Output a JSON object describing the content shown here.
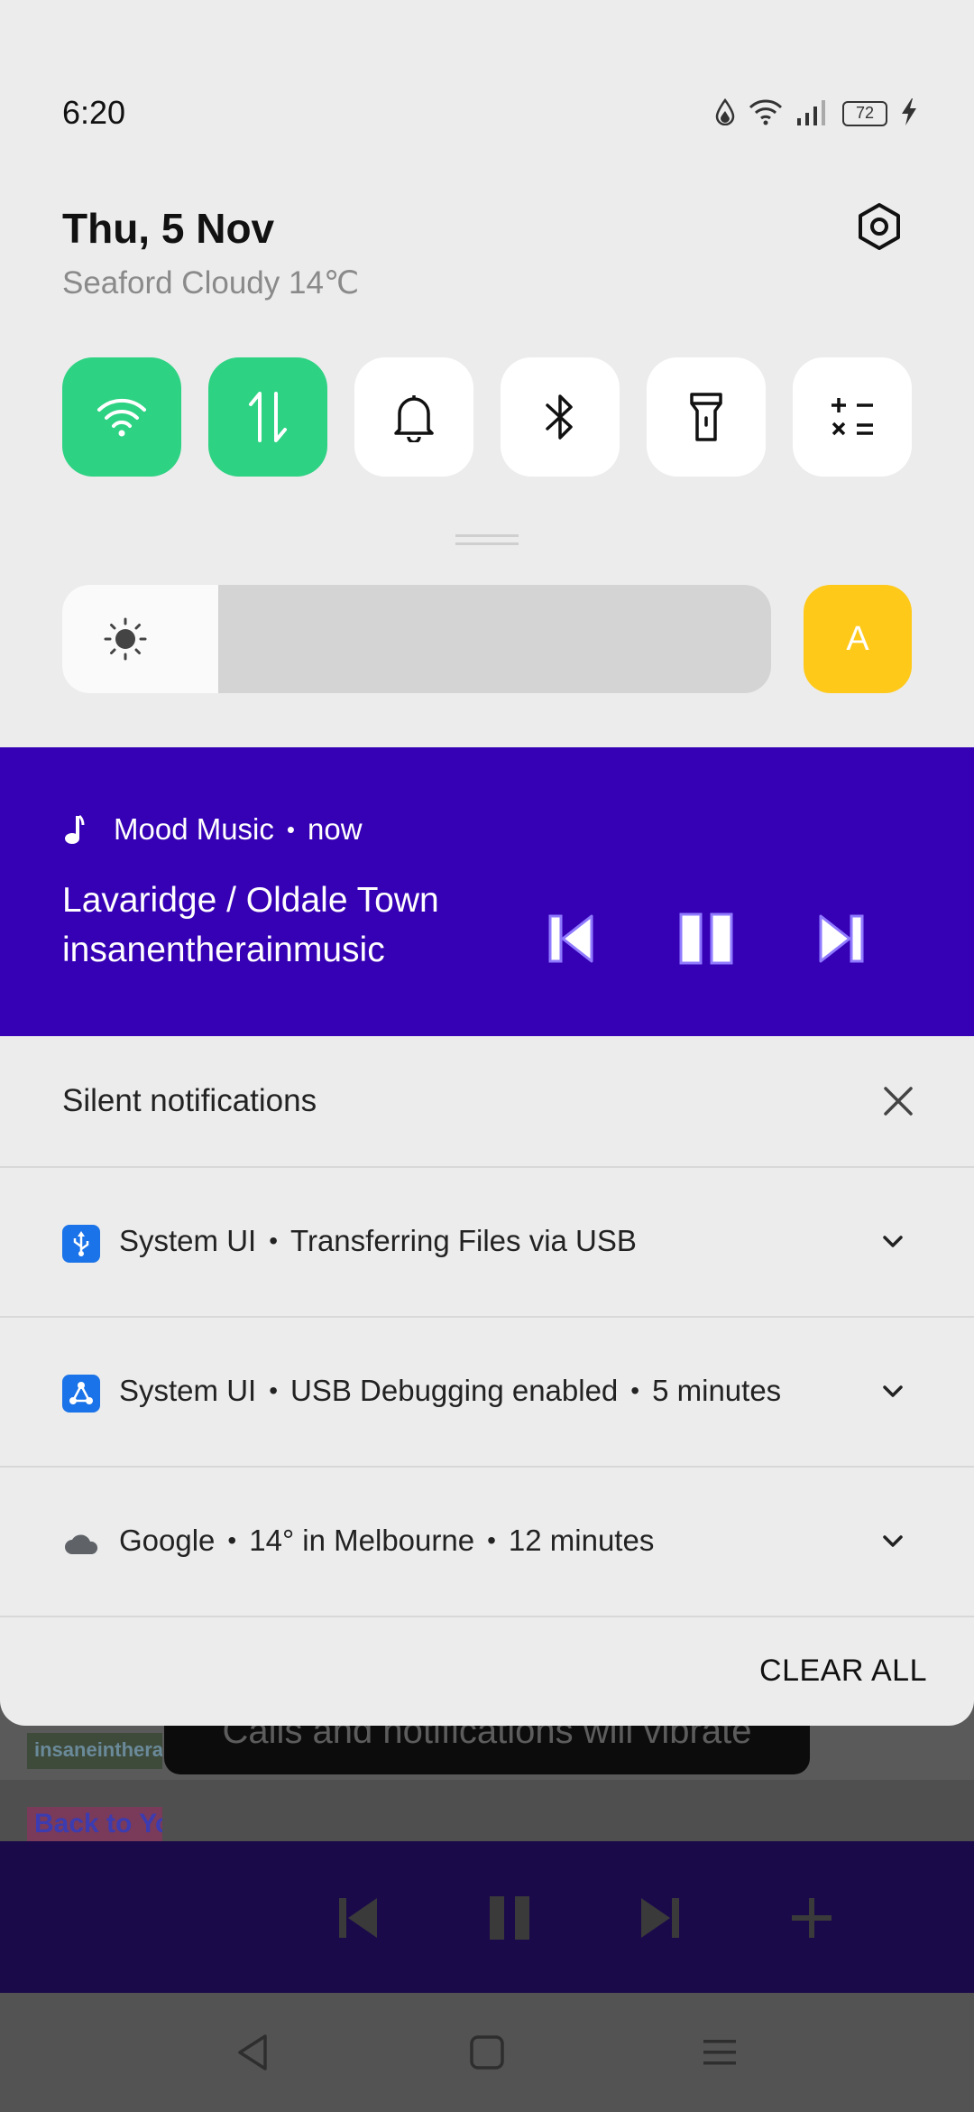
{
  "status_bar": {
    "time": "6:20",
    "battery_level": "72",
    "icons": [
      "data-saver-icon",
      "wifi-icon",
      "signal-icon",
      "battery-icon",
      "charging-icon"
    ]
  },
  "header": {
    "date": "Thu, 5 Nov",
    "weather": "Seaford Cloudy 14℃"
  },
  "quick_tiles": [
    {
      "name": "wifi",
      "icon": "wifi-icon",
      "on": true
    },
    {
      "name": "mobile-data",
      "icon": "mobile-data-icon",
      "on": true
    },
    {
      "name": "sound",
      "icon": "bell-icon",
      "on": false
    },
    {
      "name": "bluetooth",
      "icon": "bluetooth-icon",
      "on": false
    },
    {
      "name": "flashlight",
      "icon": "flashlight-icon",
      "on": false
    },
    {
      "name": "calculator",
      "icon": "calculator-icon",
      "on": false
    }
  ],
  "brightness": {
    "level": 0.22,
    "auto_label": "A"
  },
  "media": {
    "app_name": "Mood Music",
    "time": "now",
    "title": "Lavaridge / Oldale Town",
    "artist": "insanentherainmusic"
  },
  "silent": {
    "title": "Silent notifications"
  },
  "notifications": [
    {
      "app": "System UI",
      "text": "Transferring Files via USB",
      "time": "",
      "icon": "usb-icon"
    },
    {
      "app": "System UI",
      "text": "USB Debugging enabled",
      "time": "5 minutes",
      "icon": "debug-icon"
    },
    {
      "app": "Google",
      "text": "14° in Melbourne",
      "time": "12 minutes",
      "icon": "cloud-icon"
    }
  ],
  "clear_all_label": "CLEAR ALL",
  "background_app": {
    "toast": "Calls and notifications will vibrate",
    "thumb_1": "insaneintherai",
    "thumb_2": "Back to Your"
  },
  "colors": {
    "accent_green": "#2ed283",
    "media_bg": "#3600b5",
    "auto_yellow": "#ffc91a"
  }
}
